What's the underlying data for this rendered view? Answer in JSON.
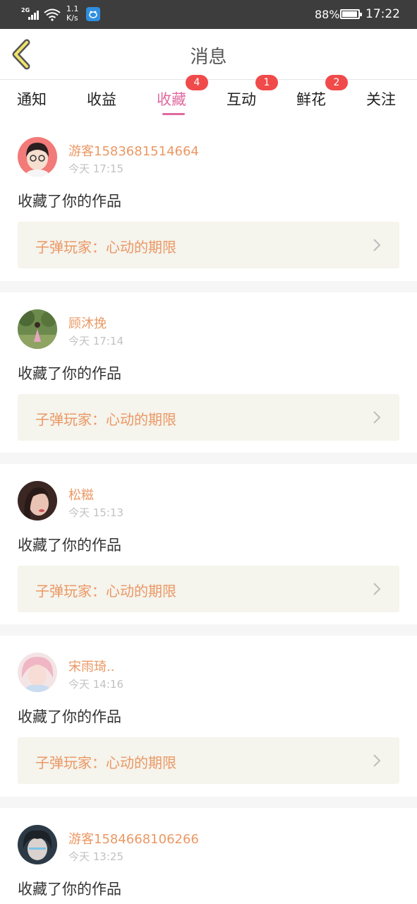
{
  "status_bar": {
    "network": "2G",
    "speed_value": "1.1",
    "speed_unit": "K/s",
    "notification_icon": "bird-app-icon",
    "battery_percent": "88%",
    "battery_level": 0.88,
    "time": "17:22"
  },
  "header": {
    "title": "消息",
    "back_icon": "chevron-left-icon"
  },
  "tabs": [
    {
      "label": "通知",
      "active": false,
      "badge": ""
    },
    {
      "label": "收益",
      "active": false,
      "badge": ""
    },
    {
      "label": "收藏",
      "active": true,
      "badge": "4"
    },
    {
      "label": "互动",
      "active": false,
      "badge": "1"
    },
    {
      "label": "鲜花",
      "active": false,
      "badge": "2"
    },
    {
      "label": "关注",
      "active": false,
      "badge": ""
    }
  ],
  "colors": {
    "accent_pink": "#e06aa0",
    "username_orange": "#eb9864",
    "badge_red": "#f04a4a",
    "work_bg": "#f5f4ed"
  },
  "messages": [
    {
      "user": "游客1583681514664",
      "time": "今天 17:15",
      "action": "收藏了你的作品",
      "work": "子弹玩家：心动的期限"
    },
    {
      "user": "顾沐挽",
      "time": "今天 17:14",
      "action": "收藏了你的作品",
      "work": "子弹玩家：心动的期限"
    },
    {
      "user": "松糍",
      "time": "今天 15:13",
      "action": "收藏了你的作品",
      "work": "子弹玩家：心动的期限"
    },
    {
      "user": "宋雨琦..",
      "time": "今天 14:16",
      "action": "收藏了你的作品",
      "work": "子弹玩家：心动的期限"
    },
    {
      "user": "游客1584668106266",
      "time": "今天 13:25",
      "action": "收藏了你的作品",
      "work": ""
    }
  ]
}
